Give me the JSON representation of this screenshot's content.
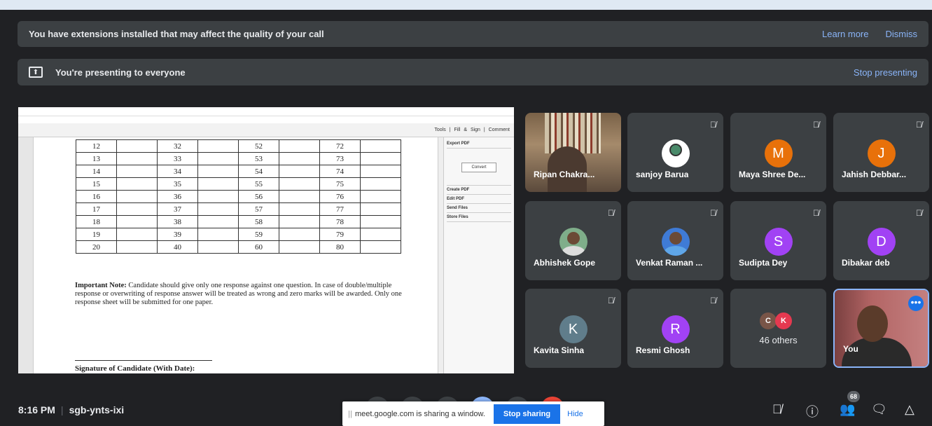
{
  "banners": {
    "extensions_message": "You have extensions installed that may affect the quality of your call",
    "learn_more": "Learn more",
    "dismiss": "Dismiss",
    "presenting_message": "You're presenting to everyone",
    "stop_presenting": "Stop presenting"
  },
  "presentation": {
    "toolbar_right": "Tools | Fill & Sign | Comment",
    "rows": [
      [
        "12",
        "32",
        "52",
        "72"
      ],
      [
        "13",
        "33",
        "53",
        "73"
      ],
      [
        "14",
        "34",
        "54",
        "74"
      ],
      [
        "15",
        "35",
        "55",
        "75"
      ],
      [
        "16",
        "36",
        "56",
        "76"
      ],
      [
        "17",
        "37",
        "57",
        "77"
      ],
      [
        "18",
        "38",
        "58",
        "78"
      ],
      [
        "19",
        "39",
        "59",
        "79"
      ],
      [
        "20",
        "40",
        "60",
        "80"
      ]
    ],
    "note_label": "Important Note:",
    "note_text": "Candidate should give only one response against one question. In case of double/multiple response or overwriting of response answer will be treated as wrong and zero marks will be awarded. Only one response sheet will be submitted for one paper.",
    "signature_label": "Signature of Candidate (With Date):",
    "side_header": "Export PDF",
    "side_button": "Convert",
    "side_items": [
      "Create PDF",
      "Edit PDF",
      "Send Files",
      "Store Files"
    ]
  },
  "participants": [
    {
      "name": "Ripan Chakra...",
      "type": "video"
    },
    {
      "name": "sanjoy Barua",
      "type": "photo"
    },
    {
      "name": "Maya Shree De...",
      "initial": "M",
      "color": "#e8710a"
    },
    {
      "name": "Jahish Debbar...",
      "initial": "J",
      "color": "#e8710a"
    },
    {
      "name": "Abhishek Gope",
      "type": "photo"
    },
    {
      "name": "Venkat Raman ...",
      "type": "photo"
    },
    {
      "name": "Sudipta Dey",
      "initial": "S",
      "color": "#a142f4"
    },
    {
      "name": "Dibakar deb",
      "initial": "D",
      "color": "#a142f4"
    },
    {
      "name": "Kavita Sinha",
      "initial": "K",
      "color": "#607d8b"
    },
    {
      "name": "Resmi Ghosh",
      "initial": "R",
      "color": "#a142f4"
    }
  ],
  "others": {
    "label": "46 others",
    "mini": [
      "C",
      "K"
    ]
  },
  "self": {
    "label": "You"
  },
  "bottom": {
    "time": "8:16 PM",
    "meeting_code": "sgb-ynts-ixi",
    "share_message": "meet.google.com is sharing a window.",
    "stop_sharing": "Stop sharing",
    "hide": "Hide",
    "people_count": "68"
  },
  "icons": [
    "present-icon",
    "mic-off-icon",
    "info-icon",
    "people-icon",
    "chat-icon",
    "activities-icon",
    "more-icon"
  ]
}
